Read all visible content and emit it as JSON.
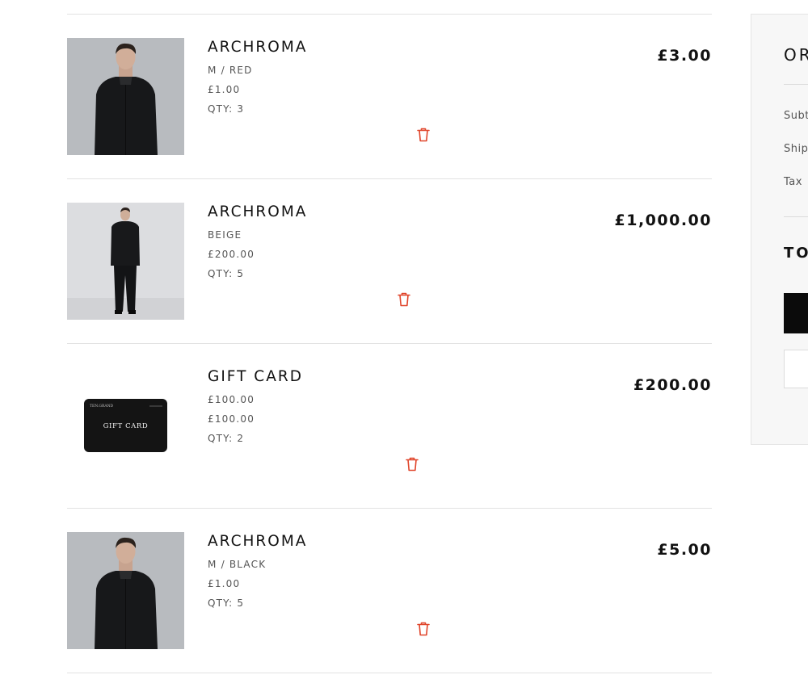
{
  "cart": {
    "items": [
      {
        "name": "ARCHROMA",
        "option": "M / RED",
        "unit_price": "£1.00",
        "quantity": "QTY: 3",
        "line_total": "£3.00",
        "image": "man-black-jacket-portrait"
      },
      {
        "name": "ARCHROMA",
        "option": "BEIGE",
        "unit_price": "£200.00",
        "quantity": "QTY: 5",
        "line_total": "£1,000.00",
        "image": "man-black-suit-full-body"
      },
      {
        "name": "GIFT CARD",
        "option": "£100.00",
        "unit_price": "£100.00",
        "quantity": "QTY: 2",
        "line_total": "£200.00",
        "image": "gift-card",
        "card_label": "GIFT CARD",
        "card_brand": "TEN.GRAND"
      },
      {
        "name": "ARCHROMA",
        "option": "M / BLACK",
        "unit_price": "£1.00",
        "quantity": "QTY: 5",
        "line_total": "£5.00",
        "image": "man-black-jacket-portrait"
      }
    ],
    "remove_icon": "trash-icon",
    "accent_color": "#e0452b"
  },
  "summary": {
    "title": "OR",
    "subtotal_label": "Subt",
    "shipping_label": "Ship",
    "tax_label": "Tax",
    "total_label": "TO"
  }
}
